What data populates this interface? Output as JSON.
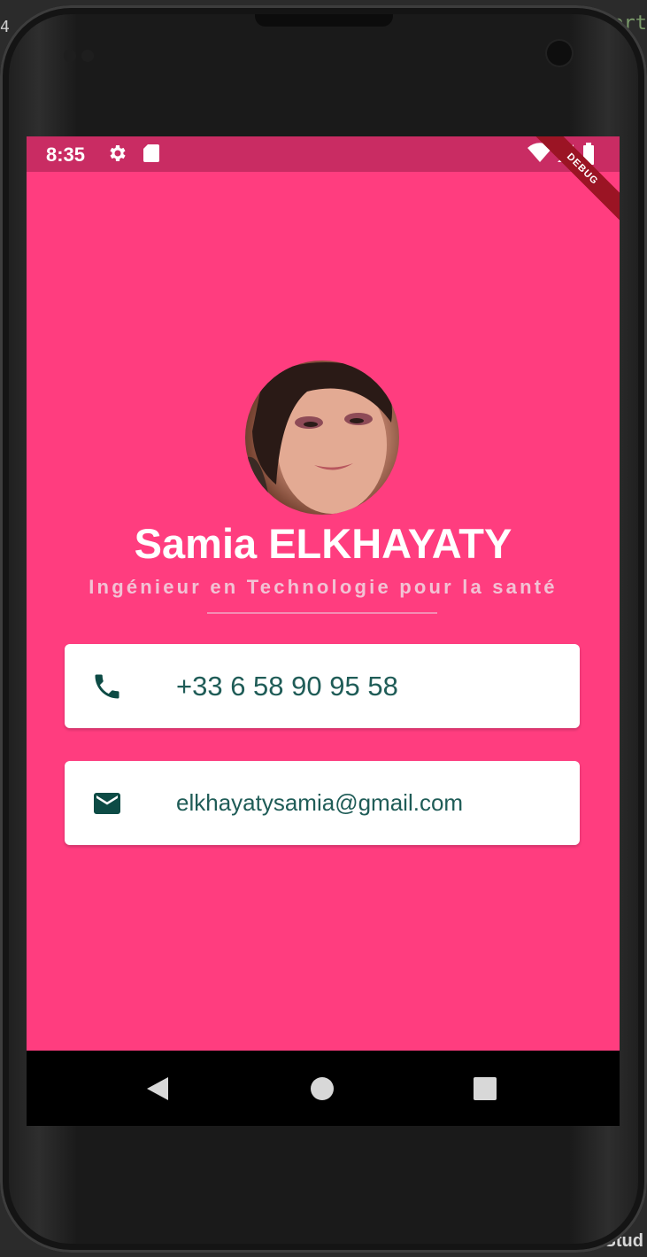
{
  "ide": {
    "line_number": "4",
    "code_fragment": "ert",
    "bottom_label": "a Stud"
  },
  "status_bar": {
    "time": "8:35",
    "icons": [
      "gear-icon",
      "sd-card-icon",
      "wifi-icon",
      "signal-icon",
      "battery-icon"
    ],
    "debug_label": "DEBUG",
    "color": "#c92c63"
  },
  "profile": {
    "name": "Samia ELKHAYATY",
    "title": "Ingénieur en Technologie pour la santé"
  },
  "contacts": {
    "phone": {
      "icon": "phone-icon",
      "value": "+33 6 58 90 95 58"
    },
    "email": {
      "icon": "mail-icon",
      "value": "elkhayatysamia@gmail.com"
    }
  },
  "nav_bar": {
    "buttons": [
      "back-icon",
      "home-icon",
      "recents-icon"
    ]
  },
  "colors": {
    "background": "#ff3d7f",
    "card_text": "#1f5c57",
    "icon": "#0d4b45"
  }
}
